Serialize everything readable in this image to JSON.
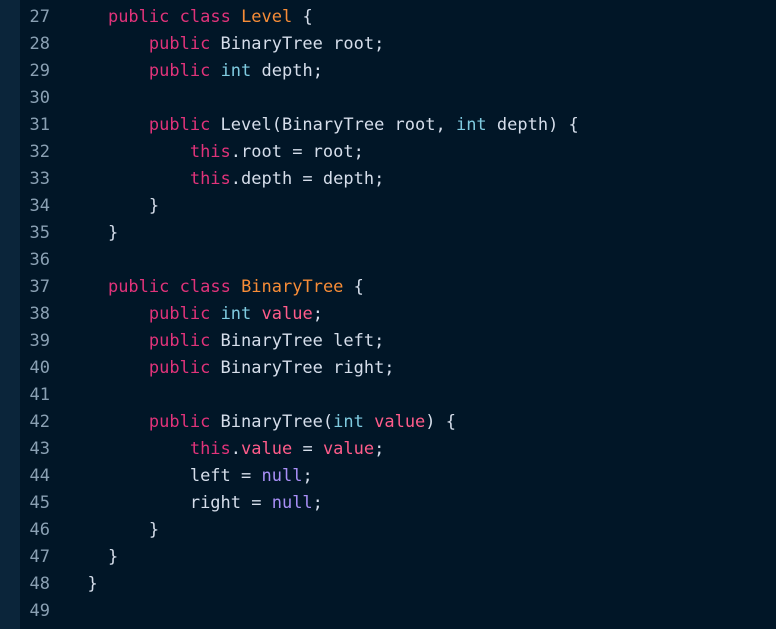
{
  "colors": {
    "background": "#011627",
    "gutter_strip": "#0b253a",
    "line_number": "#8aa0b3",
    "keyword": "#e0337a",
    "class_name": "#f78c37",
    "type": "#7fcbe0",
    "member": "#ff5c8a",
    "literal": "#a98ff6",
    "text": "#d6deeb"
  },
  "lines": [
    {
      "n": "27",
      "t": [
        [
          "",
          "    "
        ],
        [
          "kw",
          "public"
        ],
        [
          "plain",
          " "
        ],
        [
          "kw",
          "class"
        ],
        [
          "plain",
          " "
        ],
        [
          "cls",
          "Level"
        ],
        [
          "plain",
          " {"
        ]
      ]
    },
    {
      "n": "28",
      "t": [
        [
          "",
          "        "
        ],
        [
          "kw",
          "public"
        ],
        [
          "plain",
          " BinaryTree root;"
        ]
      ]
    },
    {
      "n": "29",
      "t": [
        [
          "",
          "        "
        ],
        [
          "kw",
          "public"
        ],
        [
          "plain",
          " "
        ],
        [
          "type",
          "int"
        ],
        [
          "plain",
          " depth;"
        ]
      ]
    },
    {
      "n": "30",
      "t": []
    },
    {
      "n": "31",
      "t": [
        [
          "",
          "        "
        ],
        [
          "kw",
          "public"
        ],
        [
          "plain",
          " Level(BinaryTree root, "
        ],
        [
          "type",
          "int"
        ],
        [
          "plain",
          " depth) {"
        ]
      ]
    },
    {
      "n": "32",
      "t": [
        [
          "",
          "            "
        ],
        [
          "kw",
          "this"
        ],
        [
          "plain",
          ".root = root;"
        ]
      ]
    },
    {
      "n": "33",
      "t": [
        [
          "",
          "            "
        ],
        [
          "kw",
          "this"
        ],
        [
          "plain",
          ".depth = depth;"
        ]
      ]
    },
    {
      "n": "34",
      "t": [
        [
          "",
          "        "
        ],
        [
          "plain",
          "}"
        ]
      ]
    },
    {
      "n": "35",
      "t": [
        [
          "",
          "    "
        ],
        [
          "plain",
          "}"
        ]
      ]
    },
    {
      "n": "36",
      "t": []
    },
    {
      "n": "37",
      "t": [
        [
          "",
          "    "
        ],
        [
          "kw",
          "public"
        ],
        [
          "plain",
          " "
        ],
        [
          "kw",
          "class"
        ],
        [
          "plain",
          " "
        ],
        [
          "cls",
          "BinaryTree"
        ],
        [
          "plain",
          " {"
        ]
      ]
    },
    {
      "n": "38",
      "t": [
        [
          "",
          "        "
        ],
        [
          "kw",
          "public"
        ],
        [
          "plain",
          " "
        ],
        [
          "type",
          "int"
        ],
        [
          "plain",
          " "
        ],
        [
          "val",
          "value"
        ],
        [
          "plain",
          ";"
        ]
      ]
    },
    {
      "n": "39",
      "t": [
        [
          "",
          "        "
        ],
        [
          "kw",
          "public"
        ],
        [
          "plain",
          " BinaryTree left;"
        ]
      ]
    },
    {
      "n": "40",
      "t": [
        [
          "",
          "        "
        ],
        [
          "kw",
          "public"
        ],
        [
          "plain",
          " BinaryTree right;"
        ]
      ]
    },
    {
      "n": "41",
      "t": []
    },
    {
      "n": "42",
      "t": [
        [
          "",
          "        "
        ],
        [
          "kw",
          "public"
        ],
        [
          "plain",
          " BinaryTree("
        ],
        [
          "type",
          "int"
        ],
        [
          "plain",
          " "
        ],
        [
          "val",
          "value"
        ],
        [
          "plain",
          ") {"
        ]
      ]
    },
    {
      "n": "43",
      "t": [
        [
          "",
          "            "
        ],
        [
          "kw",
          "this"
        ],
        [
          "plain",
          "."
        ],
        [
          "val",
          "value"
        ],
        [
          "plain",
          " = "
        ],
        [
          "val",
          "value"
        ],
        [
          "plain",
          ";"
        ]
      ]
    },
    {
      "n": "44",
      "t": [
        [
          "",
          "            "
        ],
        [
          "plain",
          "left = "
        ],
        [
          "lit",
          "null"
        ],
        [
          "plain",
          ";"
        ]
      ]
    },
    {
      "n": "45",
      "t": [
        [
          "",
          "            "
        ],
        [
          "plain",
          "right = "
        ],
        [
          "lit",
          "null"
        ],
        [
          "plain",
          ";"
        ]
      ]
    },
    {
      "n": "46",
      "t": [
        [
          "",
          "        "
        ],
        [
          "plain",
          "}"
        ]
      ]
    },
    {
      "n": "47",
      "t": [
        [
          "",
          "    "
        ],
        [
          "plain",
          "}"
        ]
      ]
    },
    {
      "n": "48",
      "t": [
        [
          "",
          "  "
        ],
        [
          "plain",
          "}"
        ]
      ]
    },
    {
      "n": "49",
      "t": []
    }
  ]
}
